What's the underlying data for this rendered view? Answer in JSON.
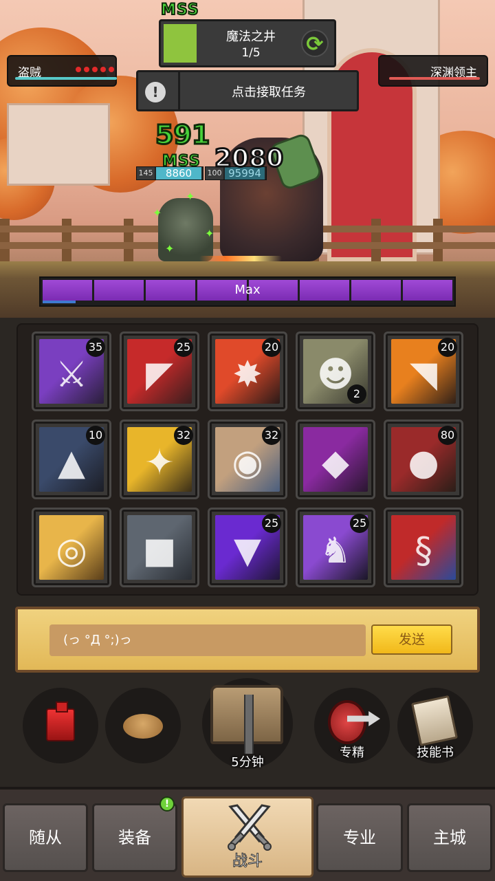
{
  "battle": {
    "left_unit": {
      "name": "盗贼",
      "dots": 5
    },
    "right_unit": {
      "name": "深渊领主"
    },
    "quest": {
      "title": "魔法之井",
      "progress": "1/5",
      "fill_fraction": 0.2
    },
    "task_prompt": "点击接取任务",
    "floating_text": {
      "miss_top": "MSS",
      "miss_lower": "MSS",
      "damage_green": "591",
      "damage_white": "2080"
    },
    "hero_hp": {
      "level": "145",
      "value": "8860"
    },
    "boss_hp": {
      "level": "100",
      "value": "95994"
    },
    "energy": {
      "label": "Max",
      "segments": 8
    }
  },
  "skills": [
    {
      "name": "lightning-sword",
      "badge": "35",
      "colors": [
        "#7a3fc0",
        "#2a1f3a"
      ]
    },
    {
      "name": "red-slash",
      "badge": "25",
      "colors": [
        "#c62a2a",
        "#3a1e1e"
      ]
    },
    {
      "name": "red-burst",
      "badge": "20",
      "colors": [
        "#e04a2a",
        "#2a1a18"
      ]
    },
    {
      "name": "masked-rogue",
      "badge": "",
      "badge_bottom": "2",
      "colors": [
        "#8a8a6a",
        "#3a3a30"
      ]
    },
    {
      "name": "orange-blade",
      "badge": "20",
      "colors": [
        "#e8801e",
        "#302018"
      ]
    },
    {
      "name": "hooded-shadow",
      "badge": "10",
      "colors": [
        "#3a4a6a",
        "#1c1e26"
      ]
    },
    {
      "name": "golden-dagger",
      "badge": "32",
      "colors": [
        "#e8b52a",
        "#3a2e18"
      ]
    },
    {
      "name": "blue-strike",
      "badge": "32",
      "colors": [
        "#c2a07e",
        "#4a5e7e"
      ]
    },
    {
      "name": "purple-mask",
      "badge": "",
      "colors": [
        "#8a2aa0",
        "#2a1630"
      ]
    },
    {
      "name": "red-sack",
      "badge": "80",
      "colors": [
        "#9a2a2a",
        "#2a1e18"
      ]
    },
    {
      "name": "golden-spiral",
      "badge": "",
      "colors": [
        "#e8b54a",
        "#5a3e1a"
      ]
    },
    {
      "name": "stone-golem",
      "badge": "",
      "colors": [
        "#5e6670",
        "#2a2e34"
      ]
    },
    {
      "name": "purple-dagger",
      "badge": "25",
      "colors": [
        "#6a2ad0",
        "#201636"
      ]
    },
    {
      "name": "dark-knight",
      "badge": "25",
      "colors": [
        "#8a4ad0",
        "#1a1626"
      ]
    },
    {
      "name": "green-serpent",
      "badge": "",
      "colors": [
        "#c02a2a",
        "#2a4a9a"
      ]
    }
  ],
  "chat": {
    "input_value": "(っ °Д °;)っ",
    "send_label": "发送"
  },
  "actions": {
    "potion": {
      "label": "",
      "icon": "potion-icon"
    },
    "bread": {
      "label": "",
      "icon": "bread-icon"
    },
    "chest": {
      "label": "5分钟",
      "icon": "treasure-chest-icon"
    },
    "elite": {
      "label": "专精",
      "icon": "elite-icon"
    },
    "skillbook": {
      "label": "技能书",
      "icon": "skill-book-icon"
    }
  },
  "nav": {
    "follower": "随从",
    "equipment": "装备",
    "battle": "战斗",
    "profession": "专业",
    "city": "主城",
    "equipment_alert": "!"
  },
  "colors": {
    "accent_yellow": "#f1b81a",
    "energy_purple": "#8f3bc6",
    "miss_green": "#48d23a"
  }
}
